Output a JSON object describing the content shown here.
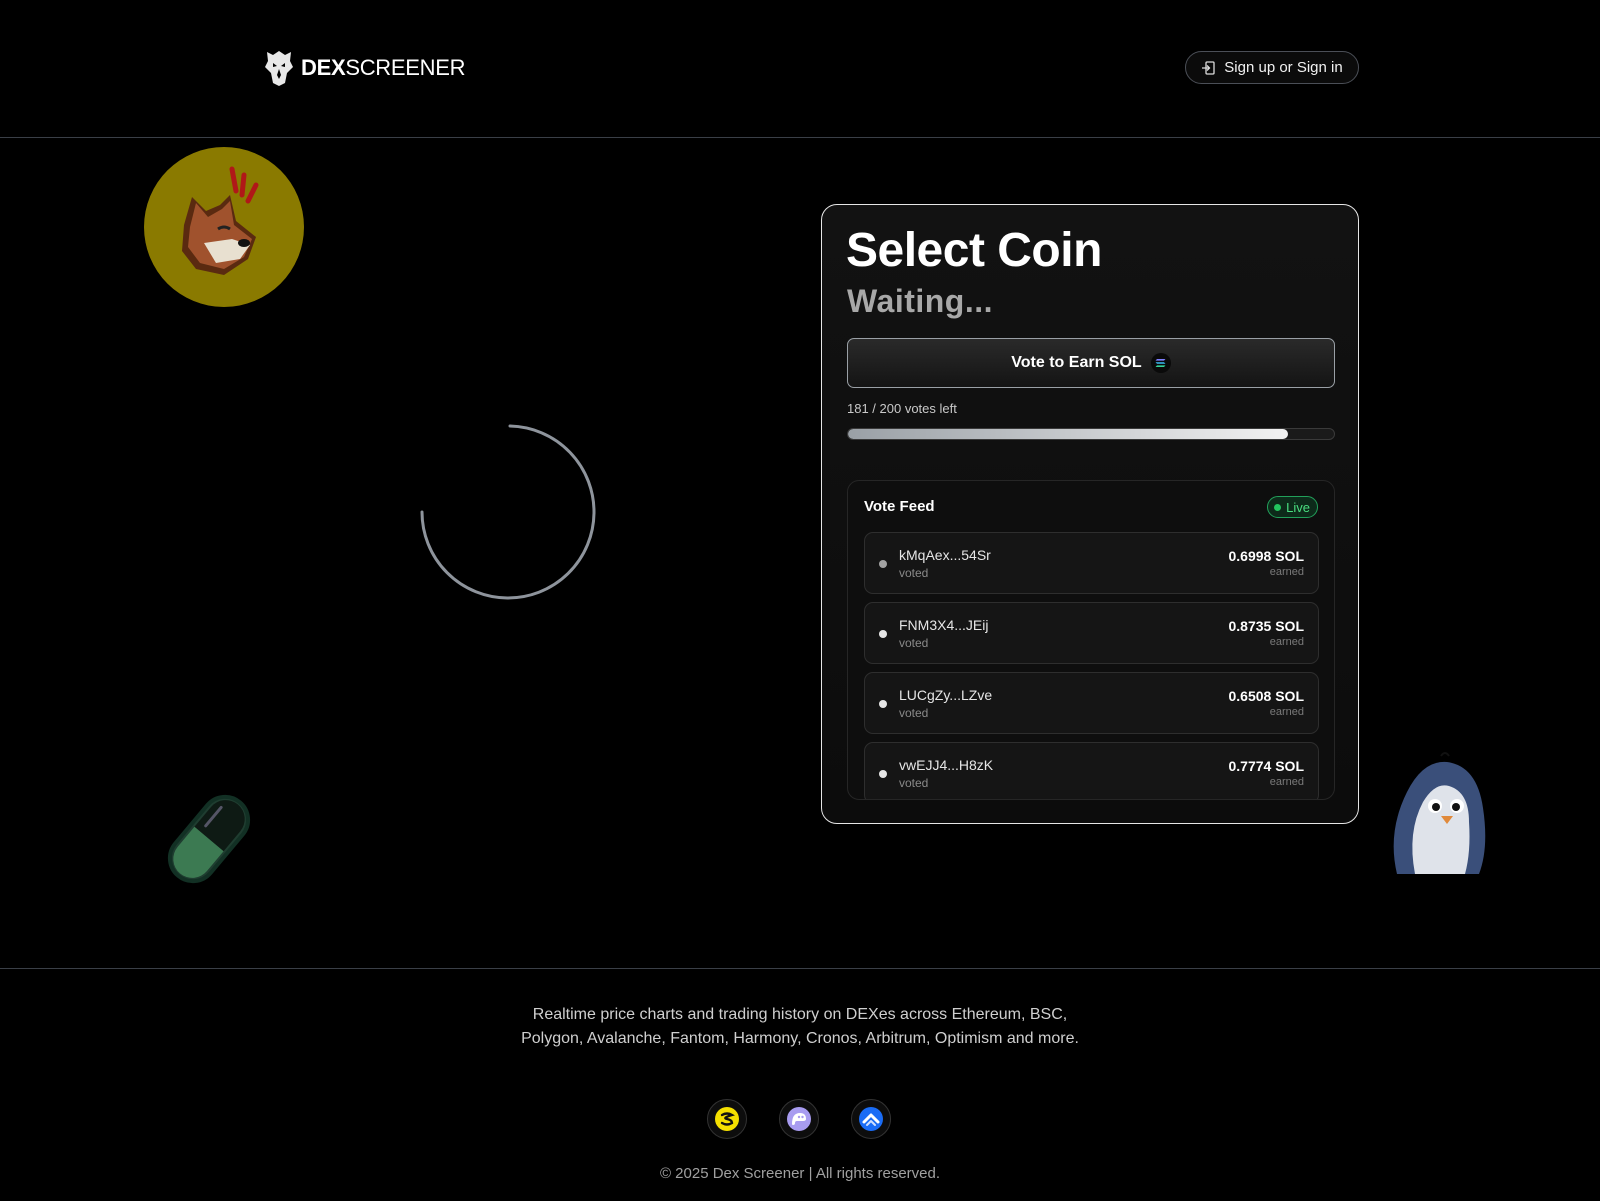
{
  "header": {
    "brand_bold": "DEX",
    "brand_light": "SCREENER",
    "signin_label": "Sign up or Sign in"
  },
  "card": {
    "title": "Select Coin",
    "subtitle": "Waiting...",
    "vote_button_label": "Vote to Earn SOL",
    "votes_left_text": "181 / 200 votes left",
    "votes_remaining": 181,
    "votes_total": 200
  },
  "feed": {
    "title": "Vote Feed",
    "live_label": "Live",
    "rows": [
      {
        "address": "kMqAex...54Sr",
        "action": "voted",
        "amount": "0.6998 SOL",
        "amount_label": "earned"
      },
      {
        "address": "FNM3X4...JEij",
        "action": "voted",
        "amount": "0.8735 SOL",
        "amount_label": "earned"
      },
      {
        "address": "LUCgZy...LZve",
        "action": "voted",
        "amount": "0.6508 SOL",
        "amount_label": "earned"
      },
      {
        "address": "vwEJJ4...H8zK",
        "action": "voted",
        "amount": "0.7774 SOL",
        "amount_label": "earned"
      }
    ]
  },
  "footer": {
    "description": "Realtime price charts and trading history on DEXes across Ethereum, BSC, Polygon, Avalanche, Fantom, Harmony, Cronos, Arbitrum, Optimism and more.",
    "socials": [
      "solscan-icon",
      "phantom-icon",
      "coinbase-wallet-icon"
    ],
    "copyright": "© 2025 Dex Screener | All rights reserved."
  },
  "colors": {
    "background": "#000000",
    "live_green": "#22c55e",
    "accent_gray": "#9aa0a6"
  }
}
